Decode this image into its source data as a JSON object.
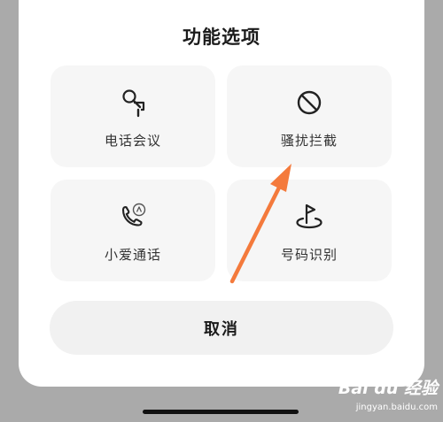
{
  "sheet": {
    "title": "功能选项"
  },
  "options": [
    {
      "label": "电话会议",
      "icon": "microphone-icon"
    },
    {
      "label": "骚扰拦截",
      "icon": "block-icon"
    },
    {
      "label": "小爱通话",
      "icon": "ai-call-icon"
    },
    {
      "label": "号码识别",
      "icon": "location-flag-icon"
    }
  ],
  "cancel_label": "取消",
  "annotation": {
    "color": "#f47a3c"
  },
  "watermark": {
    "logo": "Bai du 经验",
    "url": "jingyan.baidu.com"
  }
}
